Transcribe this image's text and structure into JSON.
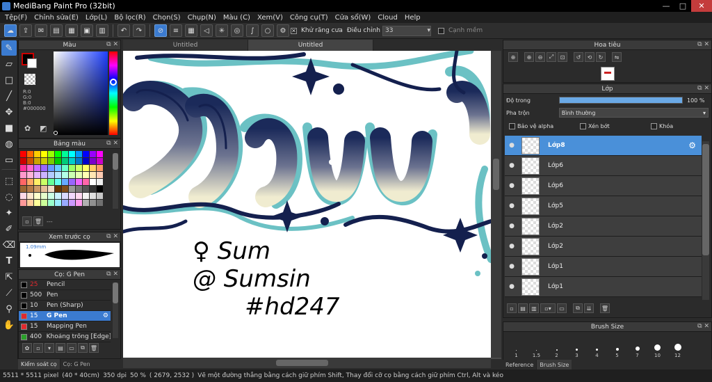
{
  "window": {
    "title": "MediBang Paint Pro (32bit)",
    "minimize": "—",
    "maximize": "□",
    "close": "✕"
  },
  "menu": [
    "Tệp(F)",
    "Chỉnh sửa(E)",
    "Lớp(L)",
    "Bộ lọc(R)",
    "Chọn(S)",
    "Chụp(N)",
    "Màu (C)",
    "Xem(V)",
    "Công cụ(T)",
    "Cửa sổ(W)",
    "Cloud",
    "Help"
  ],
  "toolbar": {
    "antialias_label": "Khử răng cưa",
    "antialias_checked": "✕",
    "adjust_label": "Điều chỉnh",
    "adjust_value": "33",
    "snap_label": "Cạnh mềm"
  },
  "color_panel": {
    "title": "Màu",
    "r": "R:0",
    "g": "G:0",
    "b": "B:0",
    "hex": "#000000"
  },
  "palette_panel": {
    "title": "Bảng màu",
    "ellipsis": "---"
  },
  "preview_panel": {
    "title": "Xem trước cọ",
    "size": "1.09mm"
  },
  "brush_panel": {
    "title": "Cọ: G Pen",
    "brushes": [
      {
        "size": "25",
        "name": "Pencil",
        "color": "#000000",
        "active": false
      },
      {
        "size": "500",
        "name": "Pen",
        "color": "#000000",
        "active": false
      },
      {
        "size": "10",
        "name": "Pen (Sharp)",
        "color": "#000000",
        "active": false
      },
      {
        "size": "15",
        "name": "G Pen",
        "color": "#e0292e",
        "active": true
      },
      {
        "size": "15",
        "name": "Mapping Pen",
        "color": "#e0292e",
        "active": false
      },
      {
        "size": "400",
        "name": "Khoảng trống [Edge]",
        "color": "#2aa12a",
        "active": false
      }
    ],
    "bottom_tab1": "Kiểm soát cọ",
    "bottom_tab2": "Cọ: G Pen"
  },
  "canvas": {
    "tab1": "Untitled",
    "tab2": "Untitled",
    "handwriting": [
      "♀ Sum",
      "@ Sumsin",
      "#hd247"
    ]
  },
  "navigator": {
    "title": "Hoa tiêu"
  },
  "layers_panel": {
    "title": "Lớp",
    "opacity_label": "Độ trong",
    "opacity_value": "100 %",
    "opacity": 100,
    "blend_label": "Pha trộn",
    "blend_value": "Bình thường",
    "protect_alpha": "Bảo vệ alpha",
    "clip": "Xén bớt",
    "lock": "Khóa",
    "layers": [
      {
        "name": "Lớp8",
        "active": true
      },
      {
        "name": "Lớp6",
        "active": false
      },
      {
        "name": "Lớp6",
        "active": false
      },
      {
        "name": "Lớp5",
        "active": false
      },
      {
        "name": "Lớp2",
        "active": false
      },
      {
        "name": "Lớp2",
        "active": false
      },
      {
        "name": "Lớp1",
        "active": false
      },
      {
        "name": "Lớp1",
        "active": false
      }
    ]
  },
  "brush_size_panel": {
    "title": "Brush Size",
    "sizes": [
      "1",
      "1.5",
      "2",
      "3",
      "4",
      "5",
      "7",
      "10",
      "12"
    ],
    "tab1": "Reference",
    "tab2": "Brush Size"
  },
  "status": {
    "size": "5511 * 5511 pixel",
    "physical": "(40 * 40cm)",
    "dpi": "350 dpi",
    "zoom": "50 %",
    "coords": "( 2679, 2532 )",
    "hint": "Vẽ một đường thẳng bằng cách giữ phím Shift, Thay đổi cỡ cọ bằng cách giữ phím Ctrl, Alt và kéo"
  }
}
